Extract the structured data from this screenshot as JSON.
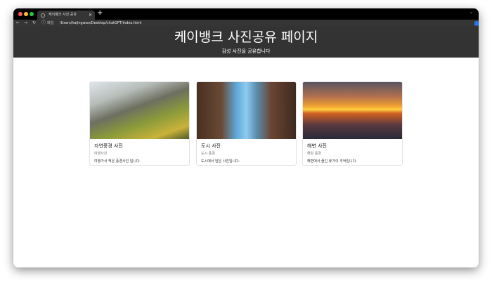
{
  "browser": {
    "tab_title": "케이뱅크 사진 공유",
    "address_label": "파일",
    "url": "/Users/hajingwan/Desktop/chatGPT/index.html"
  },
  "header": {
    "title": "케이뱅크 사진공유 페이지",
    "subtitle": "감성 사진을 공유합니다"
  },
  "cards": [
    {
      "title": "자연풍경 사진",
      "subtitle": "여행사진",
      "text": "여행가서 찍은 풍경사진 입니다."
    },
    {
      "title": "도시 사진",
      "subtitle": "도시 풍경",
      "text": "도시에서 담은 사진입니다."
    },
    {
      "title": "해변 사진",
      "subtitle": "해양 풍경",
      "text": "해변에서 즐긴 휴가의 추억입니다."
    }
  ]
}
